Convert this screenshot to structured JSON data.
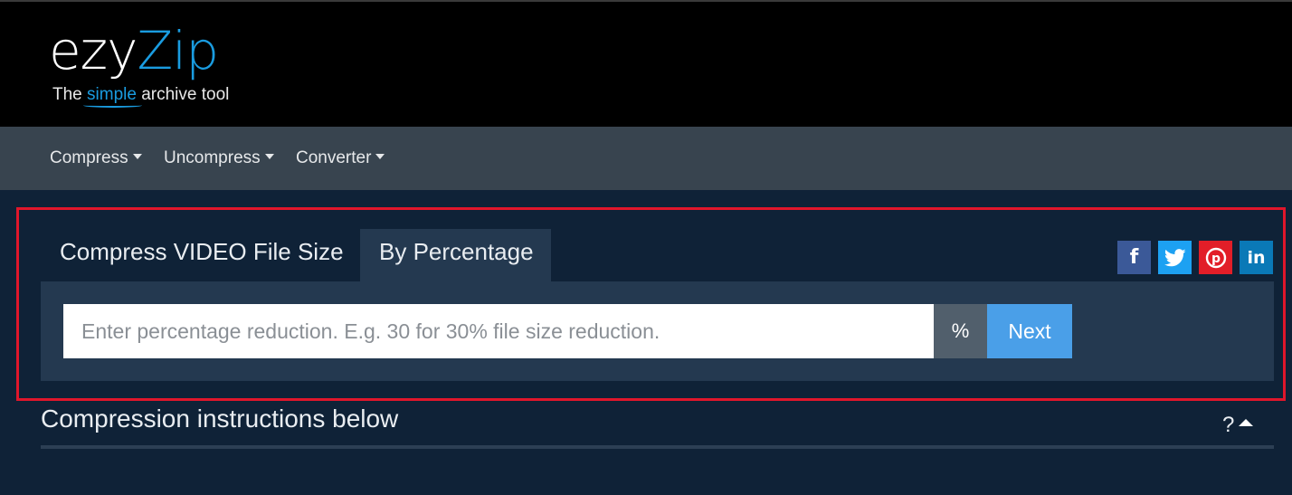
{
  "logo": {
    "ezy": "ezy",
    "zip": "Zip",
    "tagline_pre": "The ",
    "tagline_simple": "simple",
    "tagline_post": " archive tool"
  },
  "nav": {
    "items": [
      {
        "label": "Compress"
      },
      {
        "label": "Uncompress"
      },
      {
        "label": "Converter"
      }
    ]
  },
  "tabs": [
    {
      "label": "Compress VIDEO File Size",
      "active": false
    },
    {
      "label": "By Percentage",
      "active": true
    }
  ],
  "form": {
    "placeholder": "Enter percentage reduction. E.g. 30 for 30% file size reduction.",
    "value": "",
    "unit": "%",
    "next_label": "Next"
  },
  "social": [
    {
      "icon": "facebook-icon",
      "glyph": "f"
    },
    {
      "icon": "twitter-icon",
      "glyph": "🐦"
    },
    {
      "icon": "pinterest-icon",
      "glyph": "P"
    },
    {
      "icon": "linkedin-icon",
      "glyph": "in"
    }
  ],
  "instructions": {
    "title": "Compression instructions below",
    "help": "?"
  },
  "colors": {
    "brand_blue": "#1a9ce0",
    "next_button": "#4a9fe8",
    "highlight": "#e0162b",
    "background": "#0f2237"
  }
}
